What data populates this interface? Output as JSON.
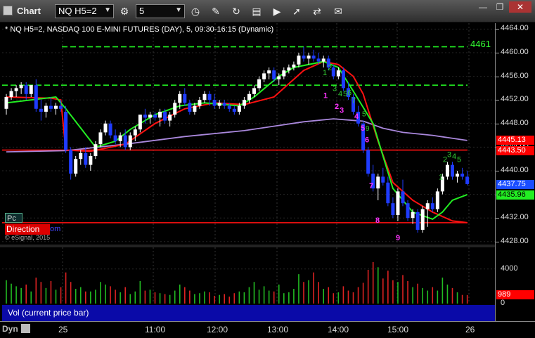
{
  "window": {
    "title": "Chart",
    "symbol": "NQ H5=2",
    "interval": "5",
    "buttons": [
      "min",
      "restore",
      "close"
    ],
    "toolbar_icons": [
      "time-icon",
      "draw-pencil-icon",
      "refresh-icon",
      "study-icon",
      "play-icon",
      "cursor-icon",
      "comment-icon"
    ]
  },
  "chart": {
    "header": "* NQ H5=2, NASDAQ 100 E-MINI FUTURES (DAY), 5, 09:30-16:15 (Dynamic)",
    "copyright": "© eSignal, 2015",
    "pc_label": "Pc",
    "direction_label": "Direction",
    "direction_ext": "om",
    "level_label": "4461",
    "y_ticks": [
      "4464.00",
      "4460.00",
      "4456.00",
      "4452.00",
      "4448.00",
      "4444.00",
      "4440.00",
      "4436.00",
      "4432.00",
      "4428.00"
    ],
    "price_boxes": [
      {
        "value": "4445.13",
        "color": "#ff0000",
        "text": "#ffffff"
      },
      {
        "value": "4443.50",
        "color": "#ff0000",
        "text": "#ffffff"
      },
      {
        "value": "4437.75",
        "color": "#1a4dff",
        "text": "#ffffff"
      },
      {
        "value": "4435.96",
        "color": "#22ee22",
        "text": "#000000"
      }
    ],
    "vol_ticks": [
      "4000",
      "0"
    ],
    "vol_box": {
      "value": "989",
      "color": "#ff0000"
    },
    "vol_label": "Vol (current price bar)",
    "time_labels": [
      "25",
      "11:00",
      "12:00",
      "13:00",
      "14:00",
      "15:00",
      "26"
    ],
    "dyn_label": "Dyn",
    "td_labels_magenta": [
      "1",
      "2",
      "3",
      "4",
      "5",
      "6",
      "7",
      "8",
      "9"
    ],
    "td_labels_green_top": [
      "1",
      "2",
      "3",
      "4",
      "5",
      "6",
      "7"
    ],
    "td_labels_green_right": [
      "1",
      "2",
      "3",
      "4",
      "5"
    ],
    "colors": {
      "up": "#ffffff",
      "down": "#1f3cff",
      "ma_green": "#22ee22",
      "ma_red": "#ff1111",
      "ma_purple": "#aa88dd",
      "vol_up": "#22bb22",
      "vol_down": "#dd2222"
    },
    "chart_data": {
      "type": "candlestick",
      "ylim": [
        4427.5,
        4465.0
      ],
      "ohlc": [
        [
          4450.5,
          4453.0,
          4449.5,
          4452.5
        ],
        [
          4452.5,
          4454.0,
          4452.0,
          4453.5
        ],
        [
          4453.5,
          4454.5,
          4452.5,
          4454.0
        ],
        [
          4454.0,
          4455.0,
          4453.0,
          4454.5
        ],
        [
          4454.5,
          4455.0,
          4452.0,
          4453.0
        ],
        [
          4453.0,
          4454.5,
          4452.5,
          4454.5
        ],
        [
          4454.5,
          4455.5,
          4450.0,
          4450.5
        ],
        [
          4450.5,
          4452.0,
          4448.5,
          4450.0
        ],
        [
          4450.0,
          4451.5,
          4449.0,
          4451.0
        ],
        [
          4451.0,
          4452.5,
          4450.0,
          4450.5
        ],
        [
          4450.5,
          4451.5,
          4449.5,
          4451.0
        ],
        [
          4451.0,
          4452.0,
          4450.0,
          4450.5
        ],
        [
          4450.0,
          4451.0,
          4443.0,
          4443.5
        ],
        [
          4443.5,
          4444.0,
          4438.5,
          4439.5
        ],
        [
          4439.5,
          4442.5,
          4439.0,
          4442.0
        ],
        [
          4442.0,
          4443.5,
          4441.0,
          4443.0
        ],
        [
          4443.0,
          4444.0,
          4440.5,
          4441.0
        ],
        [
          4441.0,
          4443.0,
          4440.0,
          4442.5
        ],
        [
          4442.5,
          4445.0,
          4442.0,
          4444.5
        ],
        [
          4444.5,
          4447.0,
          4444.0,
          4446.5
        ],
        [
          4446.5,
          4448.5,
          4446.0,
          4448.0
        ],
        [
          4448.0,
          4448.5,
          4445.5,
          4446.0
        ],
        [
          4446.0,
          4447.0,
          4444.5,
          4445.0
        ],
        [
          4445.0,
          4446.5,
          4444.0,
          4446.0
        ],
        [
          4446.0,
          4447.0,
          4443.5,
          4444.0
        ],
        [
          4444.0,
          4446.5,
          4443.5,
          4446.0
        ],
        [
          4446.0,
          4447.5,
          4445.0,
          4447.0
        ],
        [
          4447.0,
          4449.5,
          4446.5,
          4449.5
        ],
        [
          4449.5,
          4450.5,
          4448.0,
          4449.0
        ],
        [
          4449.0,
          4450.0,
          4448.0,
          4449.5
        ],
        [
          4449.5,
          4450.0,
          4448.5,
          4449.0
        ],
        [
          4449.0,
          4450.5,
          4447.5,
          4450.0
        ],
        [
          4450.0,
          4450.5,
          4448.0,
          4448.5
        ],
        [
          4448.5,
          4450.0,
          4447.5,
          4449.5
        ],
        [
          4449.5,
          4452.0,
          4449.0,
          4451.5
        ],
        [
          4451.5,
          4453.5,
          4450.5,
          4453.0
        ],
        [
          4453.0,
          4454.0,
          4451.0,
          4451.5
        ],
        [
          4451.5,
          4452.0,
          4449.5,
          4450.0
        ],
        [
          4450.0,
          4451.5,
          4449.5,
          4451.0
        ],
        [
          4451.0,
          4452.5,
          4450.5,
          4452.0
        ],
        [
          4452.0,
          4453.5,
          4451.5,
          4453.0
        ],
        [
          4453.0,
          4453.5,
          4451.0,
          4452.0
        ],
        [
          4452.0,
          4453.0,
          4450.5,
          4451.0
        ],
        [
          4451.0,
          4452.0,
          4450.5,
          4451.5
        ],
        [
          4451.5,
          4452.0,
          4450.5,
          4451.0
        ],
        [
          4451.0,
          4451.5,
          4450.0,
          4450.5
        ],
        [
          4450.5,
          4451.0,
          4449.5,
          4450.0
        ],
        [
          4450.0,
          4451.5,
          4449.5,
          4451.0
        ],
        [
          4451.0,
          4452.5,
          4450.5,
          4452.0
        ],
        [
          4452.0,
          4453.5,
          4451.5,
          4453.0
        ],
        [
          4453.0,
          4454.5,
          4452.5,
          4454.0
        ],
        [
          4454.0,
          4456.0,
          4453.5,
          4455.5
        ],
        [
          4455.5,
          4457.0,
          4455.0,
          4456.5
        ],
        [
          4456.5,
          4457.5,
          4455.5,
          4457.0
        ],
        [
          4457.0,
          4457.5,
          4455.0,
          4455.5
        ],
        [
          4455.5,
          4456.5,
          4454.5,
          4456.0
        ],
        [
          4456.0,
          4457.5,
          4455.5,
          4457.0
        ],
        [
          4457.0,
          4458.0,
          4456.5,
          4457.5
        ],
        [
          4457.5,
          4458.5,
          4457.0,
          4458.0
        ],
        [
          4458.0,
          4460.0,
          4457.5,
          4459.5
        ],
        [
          4459.5,
          4461.0,
          4458.5,
          4459.0
        ],
        [
          4459.0,
          4460.0,
          4458.0,
          4459.5
        ],
        [
          4459.5,
          4460.5,
          4458.5,
          4459.0
        ],
        [
          4459.0,
          4460.0,
          4458.0,
          4458.5
        ],
        [
          4458.5,
          4459.5,
          4457.5,
          4459.0
        ],
        [
          4459.0,
          4459.5,
          4457.0,
          4457.5
        ],
        [
          4457.5,
          4458.0,
          4455.5,
          4456.0
        ],
        [
          4456.0,
          4457.5,
          4455.5,
          4457.0
        ],
        [
          4457.0,
          4457.5,
          4453.5,
          4454.0
        ],
        [
          4454.0,
          4455.0,
          4452.0,
          4452.5
        ],
        [
          4452.5,
          4453.0,
          4449.5,
          4450.0
        ],
        [
          4450.0,
          4451.0,
          4447.5,
          4448.0
        ],
        [
          4448.0,
          4448.5,
          4443.0,
          4443.5
        ],
        [
          4443.5,
          4444.0,
          4439.0,
          4439.5
        ],
        [
          4439.5,
          4441.0,
          4436.5,
          4437.0
        ],
        [
          4437.0,
          4439.5,
          4435.0,
          4439.0
        ],
        [
          4439.0,
          4440.5,
          4437.5,
          4438.0
        ],
        [
          4438.0,
          4439.0,
          4434.0,
          4434.5
        ],
        [
          4434.5,
          4435.5,
          4432.0,
          4432.5
        ],
        [
          4432.5,
          4437.0,
          4431.5,
          4436.5
        ],
        [
          4436.5,
          4438.5,
          4434.0,
          4434.5
        ],
        [
          4434.5,
          4435.0,
          4431.5,
          4432.0
        ],
        [
          4432.0,
          4433.5,
          4431.0,
          4433.0
        ],
        [
          4433.0,
          4433.5,
          4429.5,
          4430.0
        ],
        [
          4430.0,
          4434.0,
          4429.5,
          4433.5
        ],
        [
          4433.5,
          4435.0,
          4430.5,
          4434.5
        ],
        [
          4434.5,
          4435.5,
          4433.0,
          4433.5
        ],
        [
          4433.5,
          4437.0,
          4433.0,
          4436.5
        ],
        [
          4436.5,
          4439.5,
          4436.0,
          4439.0
        ],
        [
          4439.0,
          4441.5,
          4438.5,
          4441.0
        ],
        [
          4441.0,
          4441.5,
          4438.5,
          4439.0
        ],
        [
          4439.0,
          4440.0,
          4438.0,
          4439.5
        ],
        [
          4439.5,
          4440.5,
          4438.5,
          4439.0
        ],
        [
          4439.0,
          4440.0,
          4437.5,
          4437.75
        ]
      ],
      "volume": [
        2700,
        2300,
        2000,
        1800,
        2200,
        1400,
        3000,
        2500,
        1800,
        2600,
        1600,
        1900,
        3600,
        2500,
        1700,
        1900,
        1400,
        1400,
        1600,
        2500,
        2200,
        2000,
        1600,
        1300,
        1900,
        1100,
        1400,
        2600,
        1500,
        1600,
        1300,
        1200,
        1100,
        1000,
        1500,
        2200,
        1900,
        1500,
        1100,
        1200,
        1400,
        1300,
        900,
        1000,
        1100,
        800,
        1200,
        1400,
        1300,
        1900,
        2500,
        1600,
        2000,
        1500,
        1400,
        2200,
        1200,
        1300,
        1700,
        3400,
        2500,
        2700,
        3600,
        2500,
        1700,
        1900,
        1200,
        1300,
        2000,
        1500,
        1300,
        1900,
        2400,
        3900,
        4800,
        4200,
        2900,
        3800,
        2700,
        2500,
        3300,
        2600,
        1900,
        2300,
        1800,
        1500,
        1900,
        1500,
        3000,
        2200,
        1800,
        1300,
        1000,
        989
      ],
      "ma_green": [
        [
          0,
          4451.5
        ],
        [
          10,
          4452.5
        ],
        [
          12,
          4450.5
        ],
        [
          18,
          4444
        ],
        [
          22,
          4445
        ],
        [
          25,
          4447
        ],
        [
          30,
          4449.5
        ],
        [
          35,
          4451
        ],
        [
          40,
          4451.5
        ],
        [
          47,
          4451
        ],
        [
          50,
          4452.5
        ],
        [
          55,
          4456
        ],
        [
          58,
          4457.5
        ],
        [
          64,
          4458.5
        ],
        [
          67,
          4457.5
        ],
        [
          70,
          4453.5
        ],
        [
          74,
          4448
        ],
        [
          78,
          4437
        ],
        [
          82,
          4433
        ],
        [
          86,
          4431.8
        ],
        [
          88,
          4433
        ],
        [
          90,
          4435
        ],
        [
          93,
          4435.96
        ]
      ],
      "ma_red": [
        [
          0,
          4452.5
        ],
        [
          9,
          4452.3
        ],
        [
          11,
          4452
        ],
        [
          12,
          4443.5
        ],
        [
          17,
          4443.3
        ],
        [
          24,
          4444.5
        ],
        [
          30,
          4448
        ],
        [
          36,
          4450.5
        ],
        [
          42,
          4451.5
        ],
        [
          48,
          4451.2
        ],
        [
          54,
          4452.5
        ],
        [
          60,
          4457
        ],
        [
          64,
          4458.5
        ],
        [
          67,
          4458
        ],
        [
          70,
          4456
        ],
        [
          72,
          4453
        ],
        [
          75,
          4445
        ],
        [
          78,
          4438
        ],
        [
          82,
          4435
        ],
        [
          86,
          4433
        ],
        [
          90,
          4431.5
        ],
        [
          93,
          4431.2
        ]
      ],
      "ma_purple": [
        [
          0,
          4443.2
        ],
        [
          12,
          4443.4
        ],
        [
          24,
          4444.5
        ],
        [
          36,
          4445.8
        ],
        [
          48,
          4446.8
        ],
        [
          60,
          4448.3
        ],
        [
          66,
          4448.8
        ],
        [
          72,
          4448.4
        ],
        [
          76,
          4447.2
        ],
        [
          80,
          4446.5
        ],
        [
          86,
          4446
        ],
        [
          93,
          4445.13
        ]
      ],
      "levels": [
        {
          "value": 4461.0,
          "color": "#22ee22",
          "style": "dashed"
        },
        {
          "value": 4454.5,
          "color": "#22ee22",
          "style": "dashed"
        },
        {
          "value": 4443.5,
          "color": "#ff1111",
          "style": "solid"
        },
        {
          "value": 4431.2,
          "color": "#ff1111",
          "style": "solid"
        }
      ]
    }
  }
}
